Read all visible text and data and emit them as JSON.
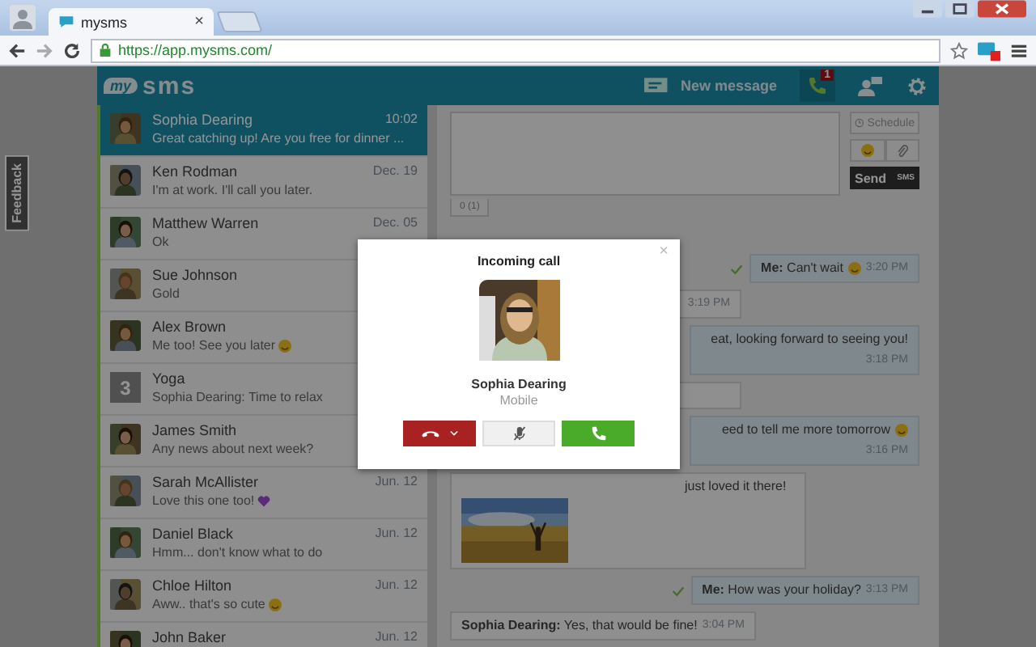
{
  "browser": {
    "tab_title": "mysms",
    "tab_close": "×",
    "url": "https://app.mysms.com/"
  },
  "header": {
    "logo_badge": "my",
    "logo": "sms",
    "new_message": "New message",
    "call_badge": "1"
  },
  "feedback": "Feedback",
  "conversations": [
    {
      "name": "Sophia Dearing",
      "preview": "Great catching up! Are you free for dinner ...",
      "time": "10:02",
      "smiley": false,
      "heart": false,
      "selected": true
    },
    {
      "name": "Ken Rodman",
      "preview": "I'm at work. I'll call you later.",
      "time": "Dec. 19",
      "smiley": false,
      "heart": false,
      "selected": false
    },
    {
      "name": "Matthew Warren",
      "preview": "Ok",
      "time": "Dec. 05",
      "smiley": false,
      "heart": false,
      "selected": false
    },
    {
      "name": "Sue Johnson",
      "preview": "Gold",
      "smiley": false,
      "heart": false,
      "selected": false
    },
    {
      "name": "Alex Brown",
      "preview": "Me too! See you later",
      "smiley": true,
      "heart": false,
      "selected": false
    },
    {
      "kind": "group",
      "count": "3",
      "name": "Yoga",
      "preview": "Sophia Dearing: Time to relax",
      "smiley": false,
      "heart": false,
      "selected": false
    },
    {
      "name": "James Smith",
      "preview": "Any news about next week?",
      "smiley": false,
      "heart": false,
      "selected": false
    },
    {
      "name": "Sarah McAllister",
      "preview": "Love this one too!",
      "smiley": false,
      "heart": true,
      "time": "Jun. 12",
      "selected": false
    },
    {
      "name": "Daniel Black",
      "preview": "Hmm... don't know what to do",
      "time": "Jun. 12",
      "smiley": false,
      "heart": false,
      "selected": false
    },
    {
      "name": "Chloe Hilton",
      "preview": "Aww.. that's so cute",
      "smiley": true,
      "heart": false,
      "time": "Jun. 12",
      "selected": false
    },
    {
      "name": "John Baker",
      "time": "Jun. 12",
      "smiley": false,
      "heart": false,
      "selected": false
    }
  ],
  "compose": {
    "schedule": "Schedule",
    "send": "Send",
    "send_type": "SMS",
    "counter": "0 (1)"
  },
  "messages": [
    {
      "kind": "out",
      "text": "**Me:** Can't wait",
      "smiley": true,
      "time": "3:20 PM",
      "delivered": true
    },
    {
      "kind": "in",
      "time": "3:19 PM",
      "smiley": false
    },
    {
      "kind": "out",
      "text": "eat, looking forward to seeing you!",
      "time": "3:18 PM",
      "smiley": false
    },
    {
      "kind": "in",
      "smiley": false
    },
    {
      "kind": "out",
      "text": "eed to tell me more tomorrow",
      "smiley": true,
      "time": "3:16 PM"
    },
    {
      "text": "just loved it there!",
      "smiley": false
    },
    {
      "kind": "out",
      "text": "**Me:** How was your holiday?",
      "time": "3:13 PM",
      "smiley": false,
      "delivered": true
    },
    {
      "kind": "in",
      "text": "**Sophia Dearing:** Yes, that would be fine!",
      "time": "3:04 PM",
      "smiley": false
    }
  ],
  "call": {
    "title": "Incoming call",
    "close": "×",
    "name": "Sophia Dearing",
    "type": "Mobile"
  }
}
